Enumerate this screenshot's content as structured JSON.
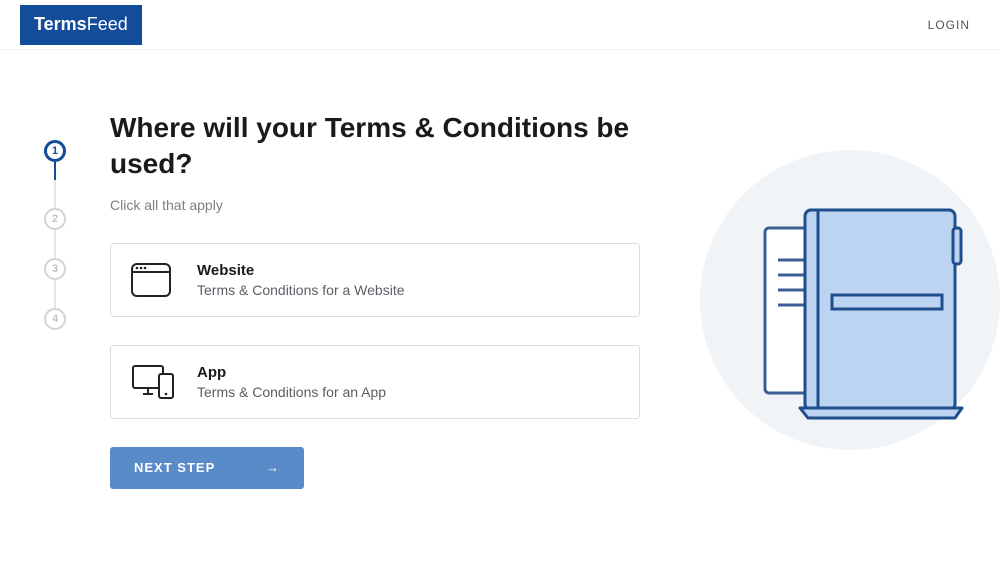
{
  "header": {
    "logo_part1": "Terms",
    "logo_part2": "Feed",
    "login": "LOGIN"
  },
  "stepper": {
    "steps": [
      "1",
      "2",
      "3",
      "4"
    ],
    "active": 0
  },
  "main": {
    "title": "Where will your Terms & Conditions be used?",
    "subtitle": "Click all that apply",
    "options": [
      {
        "title": "Website",
        "desc": "Terms & Conditions for a Website"
      },
      {
        "title": "App",
        "desc": "Terms & Conditions for an App"
      }
    ],
    "next_label": "NEXT STEP"
  }
}
